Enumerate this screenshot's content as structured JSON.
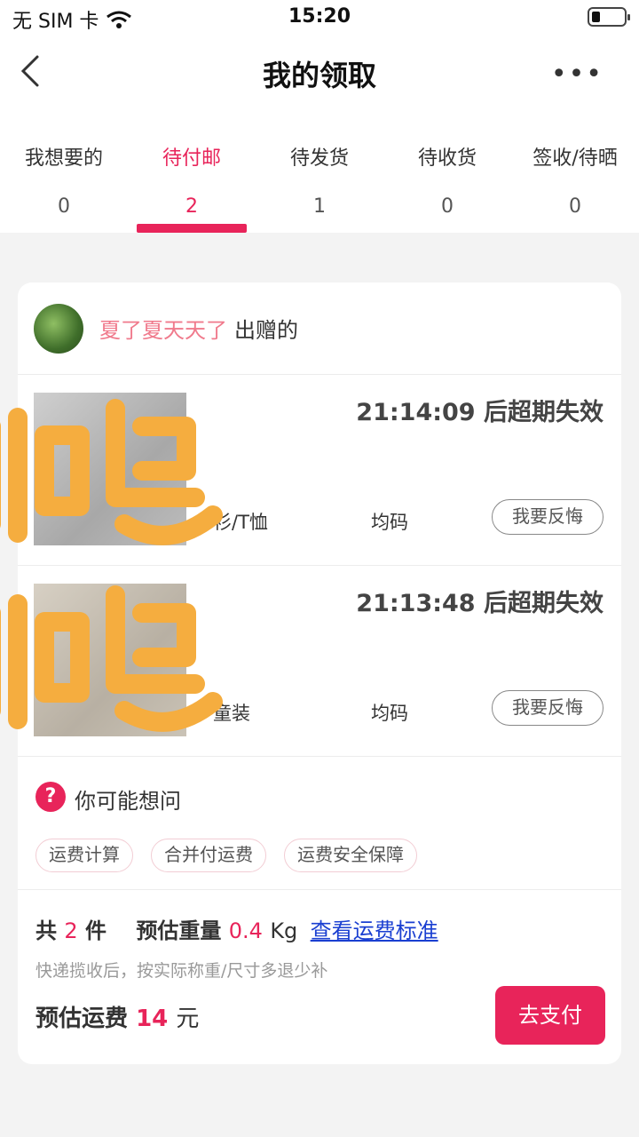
{
  "status_bar": {
    "carrier": "无 SIM 卡",
    "time": "15:20"
  },
  "nav": {
    "title": "我的领取",
    "more": "•••"
  },
  "tabs": [
    {
      "label": "我想要的",
      "count": "0"
    },
    {
      "label": "待付邮",
      "count": "2"
    },
    {
      "label": "待发货",
      "count": "1"
    },
    {
      "label": "待收货",
      "count": "0"
    },
    {
      "label": "签收/待晒",
      "count": "0"
    }
  ],
  "card": {
    "giver_name": "夏了夏天天了",
    "giver_suffix": "出赠的",
    "items": [
      {
        "timer": "21:14:09 后超期失效",
        "category": "衫/T恤",
        "size": "均码",
        "action": "我要反悔"
      },
      {
        "timer": "21:13:48 后超期失效",
        "category": "童装",
        "size": "均码",
        "action": "我要反悔"
      }
    ],
    "faq": {
      "icon": "?",
      "heading": "你可能想问",
      "chips": [
        "运费计算",
        "合并付运费",
        "运费安全保障"
      ]
    },
    "summary": {
      "total_prefix": "共",
      "total_count": "2",
      "total_unit": "件",
      "weight_label": "预估重量",
      "weight_value": "0.4",
      "weight_unit": "Kg",
      "link": "查看运费标准",
      "note": "快递揽收后，按实际称重/尺寸多退少补",
      "fee_label": "预估运费",
      "fee_value": "14",
      "fee_unit": "元",
      "pay_button": "去支付"
    }
  },
  "colors": {
    "accent": "#e8245a",
    "giver_name": "#f07a8c",
    "link": "#1a3fd1",
    "overlay": "#f5ad3f"
  }
}
